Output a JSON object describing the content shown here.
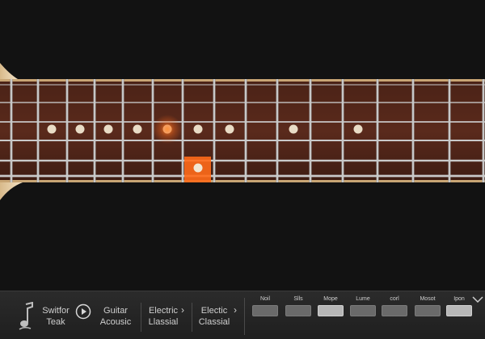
{
  "app": {
    "accent_color": "#ff6a1a",
    "highlight": {
      "string": 5,
      "fret": 7
    },
    "glow": {
      "string": 3,
      "fret": 6
    }
  },
  "fretboard": {
    "fret_count": 17,
    "string_count": 6,
    "marker_frets": [
      3,
      5,
      7,
      9,
      12,
      15,
      17
    ]
  },
  "bottom_bar": {
    "instrument_icon": "music-note-icon",
    "switch_label_line1": "Switfor",
    "switch_label_line2": "Teak",
    "play_icon": "play-icon",
    "items": [
      {
        "line1": "Guitar",
        "line2": "Acousic"
      },
      {
        "line1": "Electric",
        "line2": "Llassial"
      },
      {
        "line1": "Electic",
        "line2": "Classial"
      }
    ],
    "presets": [
      {
        "label": "Noil",
        "active": false
      },
      {
        "label": "Slls",
        "active": false
      },
      {
        "label": "Mope",
        "active": true
      },
      {
        "label": "Lume",
        "active": false
      },
      {
        "label": "corl",
        "active": false
      },
      {
        "label": "Mosot",
        "active": false
      },
      {
        "label": "Ipon",
        "active": true
      }
    ],
    "expand_icon": "chevron-down-icon"
  }
}
